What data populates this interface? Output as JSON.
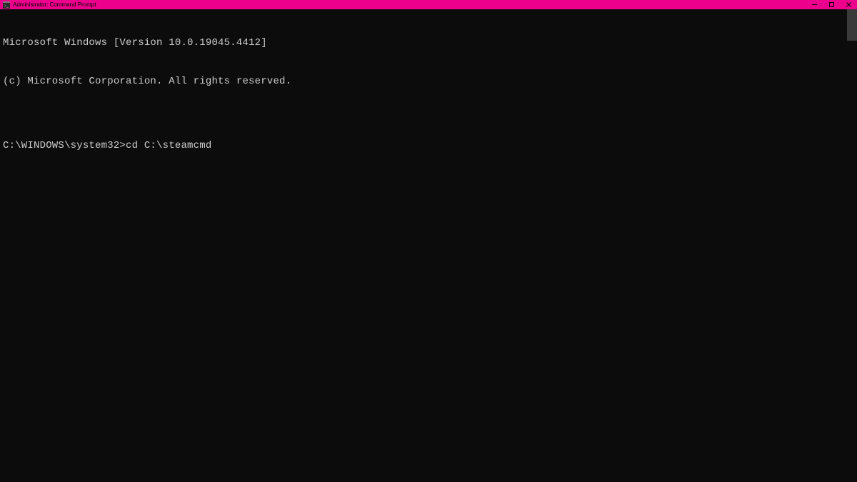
{
  "titlebar": {
    "title": "Administrator: Command Prompt"
  },
  "terminal": {
    "line1": "Microsoft Windows [Version 10.0.19045.4412]",
    "line2": "(c) Microsoft Corporation. All rights reserved.",
    "blank": "",
    "prompt": "C:\\WINDOWS\\system32>",
    "command": "cd C:\\steamcmd"
  },
  "colors": {
    "titlebar_bg": "#ec008c",
    "terminal_bg": "#0c0c0c",
    "terminal_fg": "#cccccc"
  }
}
